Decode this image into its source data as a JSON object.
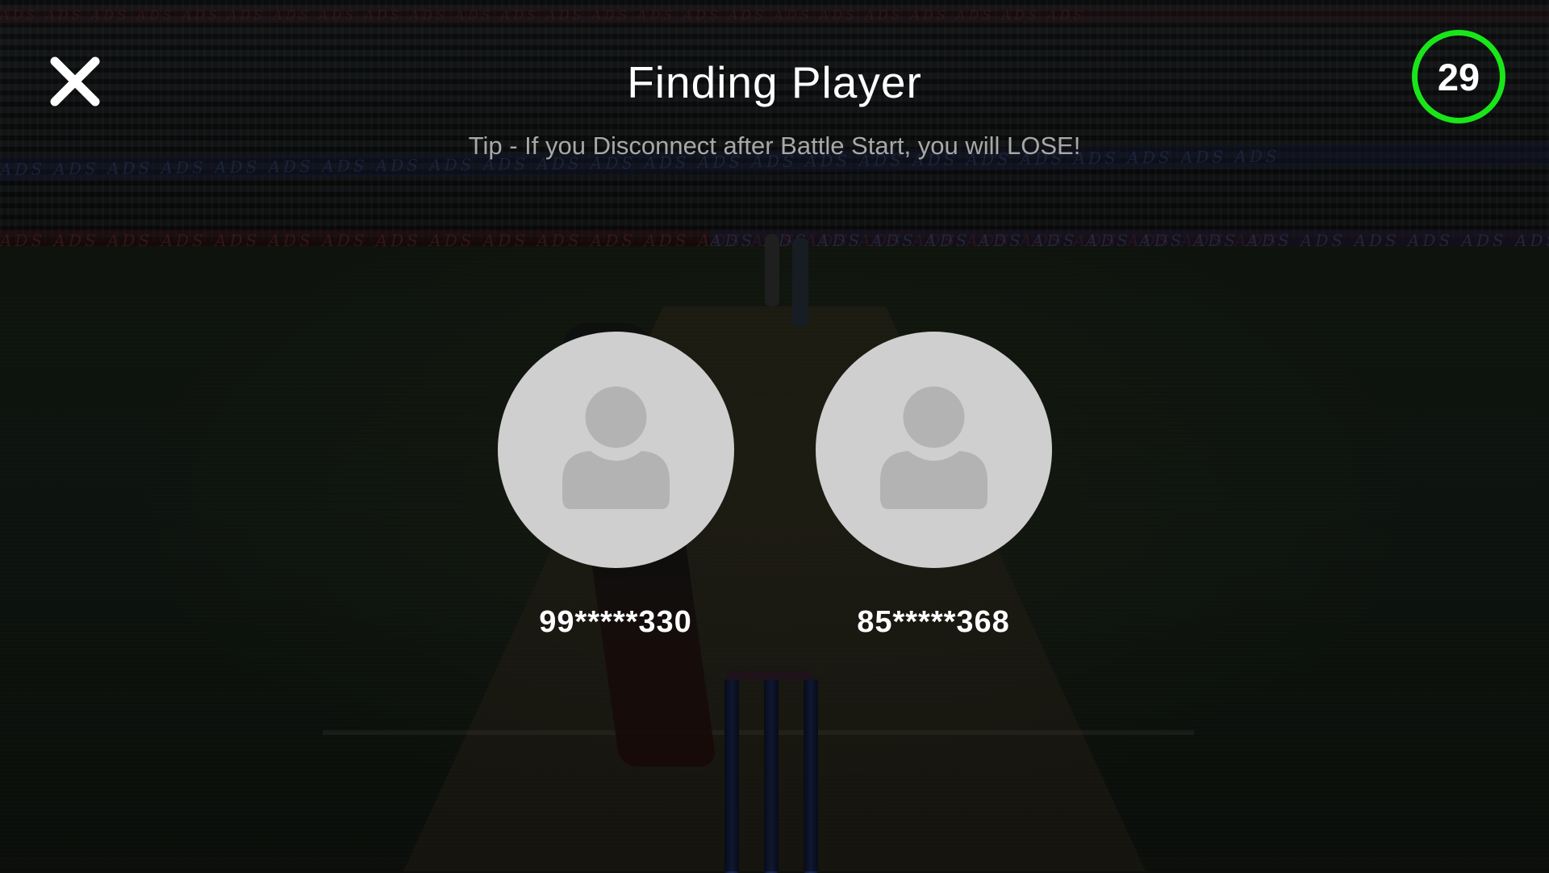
{
  "header": {
    "title": "Finding Player",
    "tip": "Tip - If you Disconnect after Battle Start, you will LOSE!"
  },
  "timer": {
    "seconds": "29",
    "ring_color": "#19e619"
  },
  "players": [
    {
      "id": "99*****330"
    },
    {
      "id": "85*****368"
    }
  ],
  "background": {
    "ad_board_text": "ADS ADS ADS ADS ADS ADS ADS ADS ADS ADS ADS ADS ADS ADS ADS ADS ADS ADS ADS ADS ADS ADS ADS ADS"
  },
  "icons": {
    "close": "close-icon",
    "avatar": "user-silhouette-icon"
  }
}
